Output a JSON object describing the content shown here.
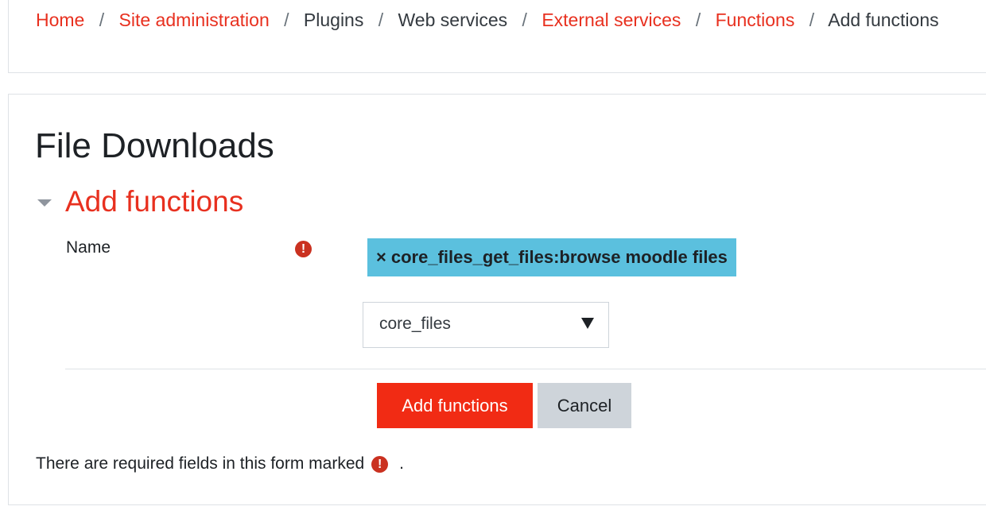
{
  "breadcrumb": {
    "items": [
      {
        "label": "Home",
        "link": true
      },
      {
        "label": "Site administration",
        "link": true
      },
      {
        "label": "Plugins",
        "link": false
      },
      {
        "label": "Web services",
        "link": false
      },
      {
        "label": "External services",
        "link": true
      },
      {
        "label": "Functions",
        "link": true
      },
      {
        "label": "Add functions",
        "link": false
      }
    ],
    "separator": "/"
  },
  "page": {
    "heading": "File Downloads"
  },
  "section": {
    "title": "Add functions"
  },
  "form": {
    "name_label": "Name",
    "required_icon": "!",
    "selected_tag": {
      "remove_symbol": "×",
      "label": "core_files_get_files:browse moodle files"
    },
    "select_value": "core_files",
    "submit_label": "Add functions",
    "cancel_label": "Cancel",
    "footnote_text": "There are required fields in this form marked",
    "footnote_end": "."
  },
  "colors": {
    "link": "#e8301f",
    "primary_button": "#f12b14",
    "secondary_button": "#ced4da",
    "tag_background": "#5bc0de",
    "required_icon": "#ca3120"
  }
}
